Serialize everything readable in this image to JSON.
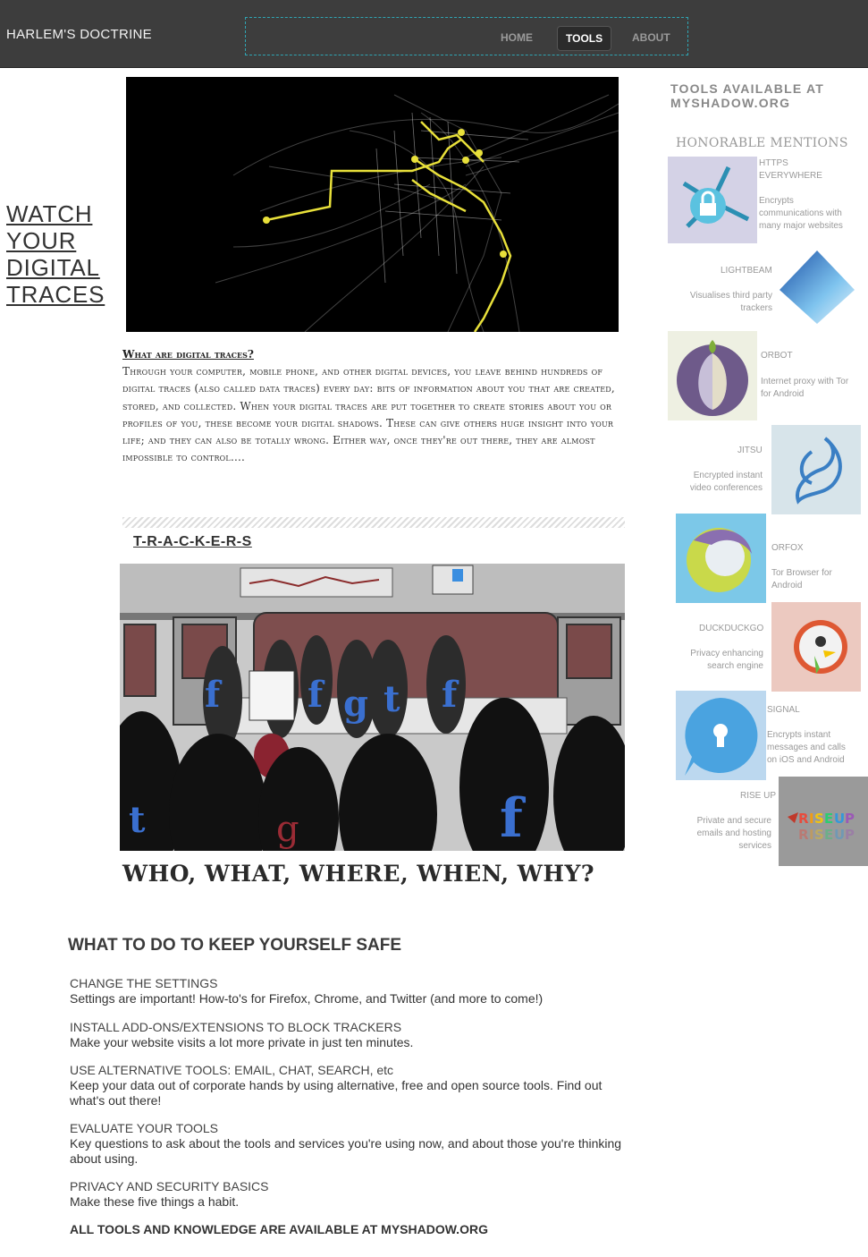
{
  "header": {
    "brand": "HARLEM'S DOCTRINE",
    "nav": [
      "HOME",
      "TOOLS",
      "ABOUT"
    ],
    "active": "TOOLS"
  },
  "hero": {
    "heading": [
      "WATCH",
      "YOUR",
      "DIGITAL",
      "TRACES"
    ]
  },
  "digital_traces": {
    "title": "What are digital traces?",
    "body": "Through your computer, mobile phone, and other digital devices, you leave behind hundreds of digital traces (also called data traces) every day: bits of information about you that are created, stored, and collected. When your digital traces are put together to create stories about you or profiles of you, these become your digital shadows. These can give others huge insight into your life; and they can also be totally wrong. Either way, once they're out there, they are almost impossible to control...."
  },
  "trackers": {
    "title": "T-R-A-C-K-E-R-S",
    "caption": "WHO, WHAT, WHERE, WHEN, WHY?"
  },
  "safe": {
    "title": "WHAT TO DO TO KEEP YOURSELF SAFE",
    "items": [
      {
        "heading": "CHANGE THE SETTINGS",
        "text": "Settings are important! How-to's for Firefox, Chrome, and Twitter (and more to come!)"
      },
      {
        "heading": "INSTALL ADD-ONS/EXTENSIONS TO BLOCK TRACKERS",
        "text": "Make your website visits a lot more private in just ten minutes."
      },
      {
        "heading": "USE ALTERNATIVE TOOLS: EMAIL, CHAT, SEARCH, etc",
        "text": "Keep your data out of corporate hands by using alternative, free and open source tools. Find out what's out there!"
      },
      {
        "heading": "EVALUATE YOUR TOOLS",
        "text": "Key questions to ask about the tools and services you're using now, and about those you're thinking about using."
      },
      {
        "heading": "PRIVACY AND SECURITY BASICS",
        "text": "Make these five things a habit."
      }
    ],
    "final": "ALL TOOLS AND KNOWLEDGE ARE AVAILABLE AT MYSHADOW.ORG"
  },
  "sidebar": {
    "title": "TOOLS AVAILABLE AT MYSHADOW.ORG",
    "subtitle": "HONORABLE MENTIONS",
    "tools": [
      {
        "name": "HTTPS EVERYWHERE",
        "desc": "Encrypts communications with many major websites",
        "icon": "https-everywhere-icon",
        "color": "#d4d2e6"
      },
      {
        "name": "LIGHTBEAM",
        "desc": "Visualises third party trackers",
        "icon": "lightbeam-icon",
        "color": "#ffffff"
      },
      {
        "name": "ORBOT",
        "desc": "Internet proxy with Tor for Android",
        "icon": "orbot-icon",
        "color": "#eef0e2"
      },
      {
        "name": "JITSU",
        "desc": "Encrypted instant video conferences",
        "icon": "jitsi-icon",
        "color": "#d7e4ea"
      },
      {
        "name": "ORFOX",
        "desc": "Tor Browser for Android",
        "icon": "orfox-icon",
        "color": "#7cc8e8"
      },
      {
        "name": "DUCKDUCKGO",
        "desc": "Privacy enhancing search engine",
        "icon": "duckduckgo-icon",
        "color": "#ecc9c0"
      },
      {
        "name": "SIGNAL",
        "desc": "Encrypts instant messages and calls on iOS and Android",
        "icon": "signal-icon",
        "color": "#bcd8ef"
      },
      {
        "name": "RISE UP",
        "desc": "Private and secure emails and hosting services",
        "icon": "riseup-icon",
        "color": "#9a9a9a"
      }
    ]
  }
}
